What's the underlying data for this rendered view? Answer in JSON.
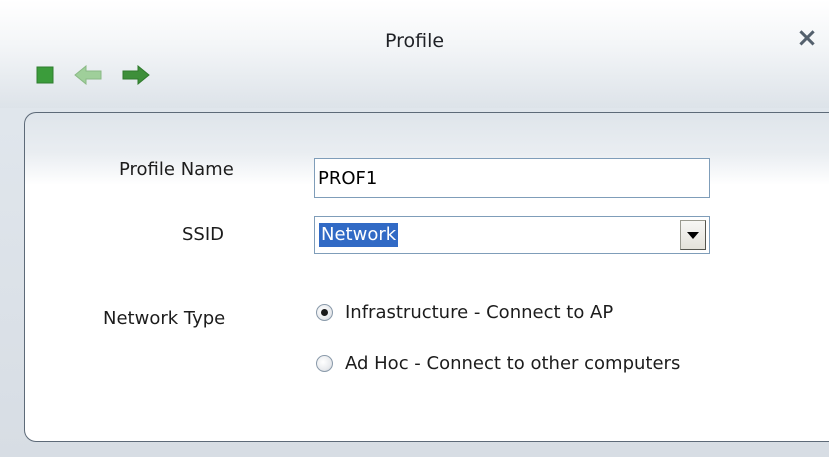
{
  "window": {
    "title": "Profile",
    "close_glyph": "×"
  },
  "toolbar": {
    "buttons": [
      {
        "icon": "stop-square-icon",
        "color": "#3b9c3b"
      },
      {
        "icon": "back-arrow-icon",
        "color": "#9fcf9a"
      },
      {
        "icon": "forward-arrow-icon",
        "color": "#3e8f3a"
      }
    ]
  },
  "form": {
    "profile_name_label": "Profile Name",
    "profile_name_value": "PROF1",
    "ssid_label": "SSID",
    "ssid_value": "Network",
    "network_type_label": "Network Type",
    "network_type_options": [
      {
        "label": "Infrastructure - Connect to AP",
        "selected": true
      },
      {
        "label": "Ad Hoc - Connect to other computers",
        "selected": false
      }
    ]
  },
  "colors": {
    "selection": "#316ac5",
    "input_border": "#7f9db9",
    "panel_border": "#5d6a78"
  }
}
